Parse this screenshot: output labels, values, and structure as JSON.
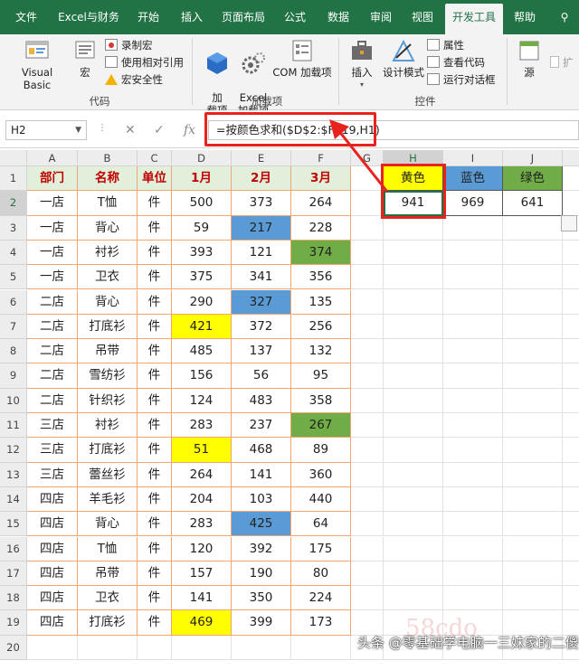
{
  "tabs": [
    "文件",
    "Excel与财务",
    "开始",
    "插入",
    "页面布局",
    "公式",
    "数据",
    "审阅",
    "视图",
    "开发工具",
    "帮助"
  ],
  "active_tab": "开发工具",
  "ribbon": {
    "code": {
      "visual_basic": "Visual Basic",
      "macro": "宏",
      "record_macro": "录制宏",
      "relative_ref": "使用相对引用",
      "macro_security": "宏安全性",
      "label": "代码"
    },
    "addins": {
      "addins_btn": "加\n载项",
      "excel_addins": "Excel\n加载项",
      "com_addins": "COM 加载项",
      "label": "加载项"
    },
    "controls": {
      "insert": "插入",
      "design_mode": "设计模式",
      "properties": "属性",
      "view_code": "查看代码",
      "run_dialog": "运行对话框",
      "label": "控件"
    },
    "xml": {
      "source": "源",
      "expand": "扩"
    }
  },
  "formula_bar": {
    "name_box": "H2",
    "formula": "=按颜色求和($D$2:$F$19,H1)"
  },
  "columns": [
    "A",
    "B",
    "C",
    "D",
    "E",
    "F",
    "G",
    "H",
    "I",
    "J"
  ],
  "table": {
    "headers": [
      "部门",
      "名称",
      "单位",
      "1月",
      "2月",
      "3月"
    ],
    "rows": [
      [
        "一店",
        "T恤",
        "件",
        "500",
        "373",
        "264"
      ],
      [
        "一店",
        "背心",
        "件",
        "59",
        "217",
        "228"
      ],
      [
        "一店",
        "衬衫",
        "件",
        "393",
        "121",
        "374"
      ],
      [
        "一店",
        "卫衣",
        "件",
        "375",
        "341",
        "356"
      ],
      [
        "二店",
        "背心",
        "件",
        "290",
        "327",
        "135"
      ],
      [
        "二店",
        "打底衫",
        "件",
        "421",
        "372",
        "256"
      ],
      [
        "二店",
        "吊带",
        "件",
        "485",
        "137",
        "132"
      ],
      [
        "二店",
        "雪纺衫",
        "件",
        "156",
        "56",
        "95"
      ],
      [
        "二店",
        "针织衫",
        "件",
        "124",
        "483",
        "358"
      ],
      [
        "三店",
        "衬衫",
        "件",
        "283",
        "237",
        "267"
      ],
      [
        "三店",
        "打底衫",
        "件",
        "51",
        "468",
        "89"
      ],
      [
        "三店",
        "蕾丝衫",
        "件",
        "264",
        "141",
        "360"
      ],
      [
        "四店",
        "羊毛衫",
        "件",
        "204",
        "103",
        "440"
      ],
      [
        "四店",
        "背心",
        "件",
        "283",
        "425",
        "64"
      ],
      [
        "四店",
        "T恤",
        "件",
        "120",
        "392",
        "175"
      ],
      [
        "四店",
        "吊带",
        "件",
        "157",
        "190",
        "80"
      ],
      [
        "四店",
        "卫衣",
        "件",
        "141",
        "350",
        "224"
      ],
      [
        "四店",
        "打底衫",
        "件",
        "469",
        "399",
        "173"
      ]
    ],
    "highlights": [
      {
        "row": 2,
        "col": 4,
        "color": "#5b9bd5"
      },
      {
        "row": 3,
        "col": 5,
        "color": "#70ad47"
      },
      {
        "row": 5,
        "col": 4,
        "color": "#5b9bd5"
      },
      {
        "row": 6,
        "col": 3,
        "color": "#ffff00"
      },
      {
        "row": 10,
        "col": 5,
        "color": "#70ad47"
      },
      {
        "row": 11,
        "col": 3,
        "color": "#ffff00"
      },
      {
        "row": 14,
        "col": 4,
        "color": "#5b9bd5"
      },
      {
        "row": 18,
        "col": 3,
        "color": "#ffff00"
      }
    ]
  },
  "summary": {
    "headers": [
      "黄色",
      "蓝色",
      "绿色"
    ],
    "header_colors": [
      "#ffff00",
      "#5b9bd5",
      "#70ad47"
    ],
    "values": [
      "941",
      "969",
      "641"
    ]
  },
  "row_count": 20,
  "watermark": "头条 @零基础学电脑一三妹家的二傻子",
  "watermark_logo": "58cdo"
}
